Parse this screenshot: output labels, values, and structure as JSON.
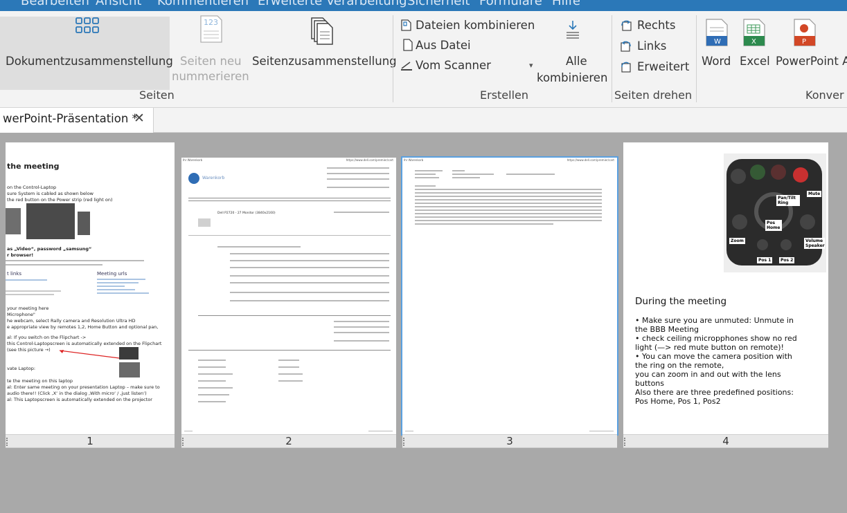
{
  "menubar": {
    "items": [
      "Bearbeiten",
      "Ansicht",
      "Kommentieren",
      "Erweiterte Verarbeitung",
      "Sicherheit",
      "Formulare",
      "Hilfe"
    ]
  },
  "ribbon": {
    "seiten": {
      "dokumentzusammenstellung": "Dokumentzusammenstellung",
      "seiten_neu_line1": "Seiten neu",
      "seiten_neu_line2": "nummerieren",
      "seitenzusammenstellung": "Seitenzusammenstellung",
      "group_label": "Seiten"
    },
    "erstellen": {
      "dateien_kombinieren": "Dateien kombinieren",
      "aus_datei": "Aus Datei",
      "vom_scanner": "Vom Scanner",
      "alle_line1": "Alle",
      "alle_line2": "kombinieren",
      "group_label": "Erstellen"
    },
    "drehen": {
      "rechts": "Rechts",
      "links": "Links",
      "erweitert": "Erweitert",
      "group_label": "Seiten drehen"
    },
    "konvert": {
      "word": "Word",
      "excel": "Excel",
      "powerpoint": "PowerPoint A",
      "group_label": "Konver",
      "word_letter": "W",
      "excel_letter": "X",
      "ppt_letter": "P"
    },
    "accent": "#2b78b8"
  },
  "tab": {
    "title": "werPoint-Präsentation *",
    "close": "✕"
  },
  "pages": {
    "numbers": [
      "1",
      "2",
      "3",
      "4"
    ],
    "selected_index": 3,
    "p1": {
      "heading": "the meeting",
      "lines": [
        "on the Control-Laptop",
        "sure System is cabled as shown below",
        "the red button on the Power strip (red light on)",
        "as „Video“, password „samsung“",
        "r browser!",
        "t links",
        "Meeting urls",
        "your meeting here",
        "Microphone\"",
        "he webcam, select Rally camera and Resolution Ultra HD",
        "e appropriate view by remotes 1,2, Home Button and optional pan,",
        "al: If you switch on the Flipchart ->",
        "this Control-Laptopscreen is automatically extended on the Flipchart",
        "(see this picture →)",
        "vate Laptop:",
        "te the meeting on this laptop",
        "al: Enter same meeting on your presentation Laptop – make sure to",
        "audio there!! (Click ‚X‘ in the dialog ‚With micro‘ / ‚just listen‘)",
        "al: This Laptopscreen is automatically extended on the projector"
      ]
    },
    "p2": {
      "header_left": "Ihr Warenkorb",
      "header_right": "https://www.dell.com/premier/cart",
      "brand": "Warenkorb",
      "item": "Dell P2720 - 27 Monitor (3840x2160)"
    },
    "p3": {
      "header_left": "Ihr Warenkorb",
      "header_right": "https://www.dell.com/premier/cart"
    },
    "p4": {
      "heading": "During the meeting",
      "bullets": [
        "• Make sure you are unmuted: Unmute in",
        "   the BBB Meeting",
        "• check ceiling micropphones show no red",
        "   light (—> red mute button on remote)!",
        "• You can move the camera position with",
        "   the ring on the remote,",
        "   you can zoom in and out with the lens",
        "   buttons",
        "   Also there are three predefined positions:",
        "   Pos Home, Pos 1, Pos2"
      ],
      "remote_labels": {
        "mute": "Mute",
        "pantilt": "Pan/Tilt Ring",
        "poshome": "Pos Home",
        "zoom": "Zoom",
        "volume": "Volume Speaker",
        "pos1": "Pos 1",
        "pos2": "Pos 2"
      }
    }
  }
}
